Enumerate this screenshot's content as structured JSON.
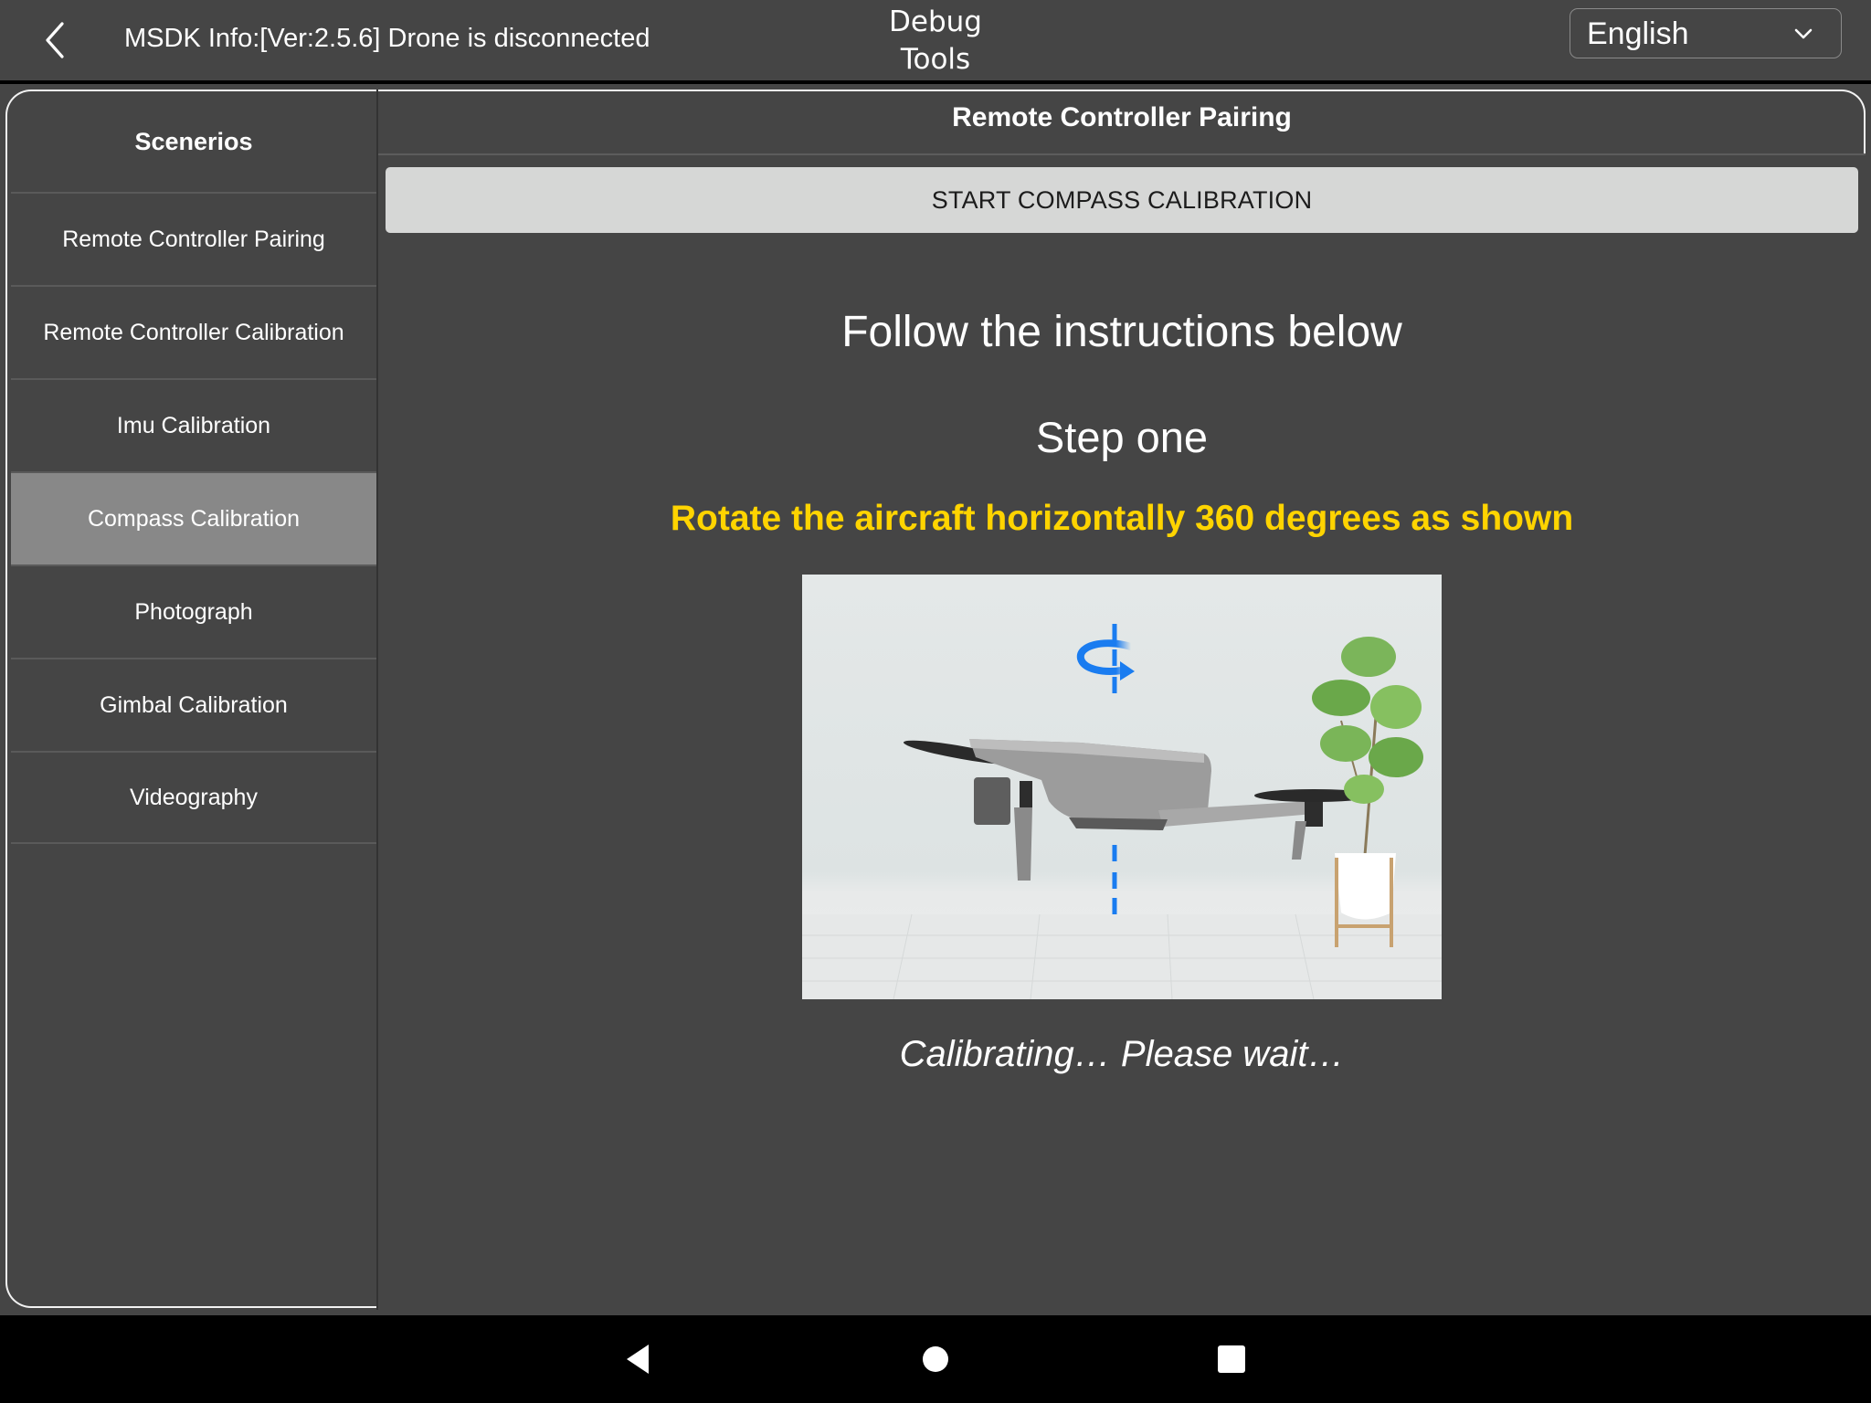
{
  "header": {
    "back_icon": "chevron-left-icon",
    "sdk_info": "MSDK Info:[Ver:2.5.6] Drone is disconnected",
    "title_line1": "Debug",
    "title_line2": "Tools",
    "language": {
      "selected": "English",
      "icon": "chevron-down-icon"
    }
  },
  "sidebar": {
    "header": "Scenerios",
    "items": [
      {
        "label": "Remote Controller Pairing",
        "active": false
      },
      {
        "label": "Remote Controller Calibration",
        "active": false
      },
      {
        "label": "Imu Calibration",
        "active": false
      },
      {
        "label": "Compass Calibration",
        "active": true
      },
      {
        "label": "Photograph",
        "active": false
      },
      {
        "label": "Gimbal Calibration",
        "active": false
      },
      {
        "label": "Videography",
        "active": false
      }
    ]
  },
  "main": {
    "title": "Remote Controller Pairing",
    "start_button": "START COMPASS CALIBRATION",
    "instructions_title": "Follow the instructions below",
    "step_label": "Step one",
    "step_description": "Rotate the aircraft horizontally 360 degrees as shown",
    "illustration": "drone-rotation-illustration",
    "status": "Calibrating… Please wait…"
  },
  "colors": {
    "background": "#454545",
    "highlight": "#ffd400",
    "active_item": "#888888",
    "button_bg": "#d6d7d6",
    "rotation_arrow": "#1a7cf0"
  },
  "navbar": {
    "back": "nav-back-icon",
    "home": "nav-home-icon",
    "recents": "nav-recents-icon"
  }
}
